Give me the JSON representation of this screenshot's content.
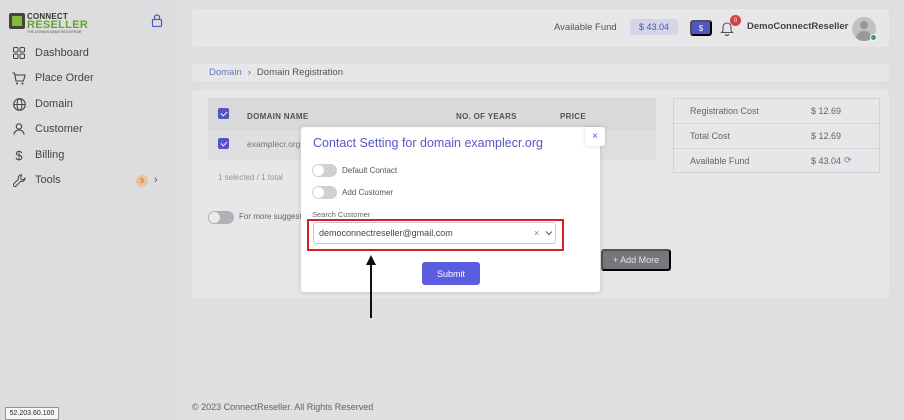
{
  "logo": {
    "line1": "CONNECT",
    "line2": "RESELLER",
    "tagline": "THE DOMAIN NAME REGISTRAR"
  },
  "sidebar": {
    "items": [
      {
        "label": "Dashboard",
        "icon": "grid-icon"
      },
      {
        "label": "Place Order",
        "icon": "cart-icon"
      },
      {
        "label": "Domain",
        "icon": "globe-icon"
      },
      {
        "label": "Customer",
        "icon": "user-icon"
      },
      {
        "label": "Billing",
        "icon": "dollar-icon"
      },
      {
        "label": "Tools",
        "icon": "wrench-icon",
        "badge": "9"
      }
    ]
  },
  "topbar": {
    "fund_label": "Available Fund",
    "fund_value": "$ 43.04",
    "dollar_button": "$",
    "notification_count": "0",
    "username": "DemoConnectReseller"
  },
  "breadcrumb": {
    "link": "Domain",
    "separator": "›",
    "current": "Domain Registration"
  },
  "table": {
    "headers": {
      "domain": "DOMAIN NAME",
      "years": "NO. OF YEARS",
      "price": "PRICE"
    },
    "row": {
      "domain": "examplecr.org"
    },
    "selected_info": "1 selected / 1 total"
  },
  "suggestions_label": "For more suggestions",
  "add_more_label": "+ Add More",
  "summary": {
    "rows": [
      {
        "label": "Registration Cost",
        "value": "$ 12.69"
      },
      {
        "label": "Total Cost",
        "value": "$ 12.69"
      },
      {
        "label": "Available Fund",
        "value": "$ 43.04"
      }
    ]
  },
  "modal": {
    "title": "Contact Setting for domain examplecr.org",
    "close": "×",
    "toggle_default": "Default Contact",
    "toggle_add": "Add Customer",
    "search_label": "Search Customer",
    "search_value": "democonnectreseller@gmail.com",
    "clear": "×",
    "submit": "Submit"
  },
  "footer": "© 2023 ConnectReseller. All Rights Reserved",
  "ip": "52.203.60.100",
  "colors": {
    "accent": "#5558c8",
    "highlight": "#d81f26",
    "success": "#3aa85a"
  }
}
